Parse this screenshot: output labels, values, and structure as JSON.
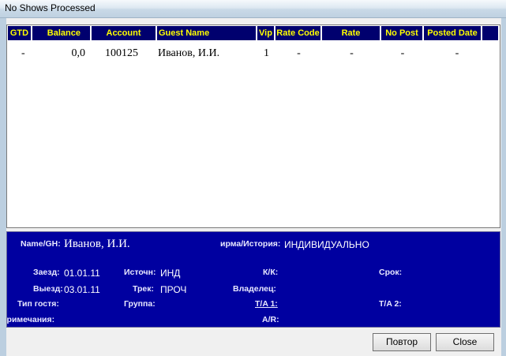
{
  "window": {
    "title": "No Shows Processed"
  },
  "grid": {
    "columns": [
      "GTD",
      "Balance",
      "Account",
      "Guest Name",
      "Vip",
      "Rate Code",
      "Rate",
      "No Post",
      "Posted Date"
    ],
    "rows": [
      {
        "gtd": "-",
        "balance": "0,0",
        "account": "100125",
        "guest_name": "Иванов, И.И.",
        "vip": "1",
        "rate_code": "-",
        "rate": "-",
        "no_post": "-",
        "posted_date": "-"
      }
    ]
  },
  "details": {
    "name_label": "Name/GH:",
    "name_value": "Иванов, И.И.",
    "firm_label": "ирма/История:",
    "firm_value": "ИНДИВИДУАЛЬНО",
    "arrival_label": "Заезд:",
    "arrival_value": "01.01.11",
    "source_label": "Источн:",
    "source_value": "ИНД",
    "cc_label": "К/К:",
    "term_label": "Срок:",
    "departure_label": "Выезд:",
    "departure_value": "03.01.11",
    "track_label": "Трек:",
    "track_value": "ПРОЧ",
    "owner_label": "Владелец:",
    "guest_type_label": "Тип гостя:",
    "group_label": "Группа:",
    "ta1_label": "T/A 1:",
    "ta2_label": "T/A 2:",
    "notes_label": "Примечания:",
    "ar_label": "A/R:"
  },
  "buttons": {
    "repeat": "Повтор",
    "close": "Close"
  }
}
